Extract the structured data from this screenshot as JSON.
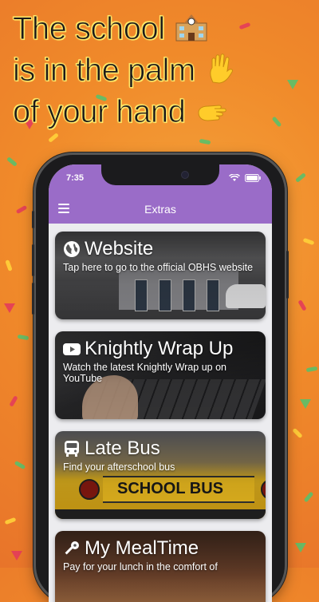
{
  "headline": {
    "line1": "The school",
    "line2": "is in the palm",
    "line3": "of your hand"
  },
  "status_bar": {
    "time": "7:35"
  },
  "nav": {
    "title": "Extras"
  },
  "cards": [
    {
      "title": "Website",
      "subtitle": "Tap here to go to the official OBHS website",
      "icon": "globe-icon"
    },
    {
      "title": "Knightly Wrap Up",
      "subtitle": "Watch the latest Knightly Wrap up on YouTube",
      "icon": "youtube-icon"
    },
    {
      "title": "Late Bus",
      "subtitle": "Find your afterschool bus",
      "icon": "bus-icon"
    },
    {
      "title": "My MealTime",
      "subtitle": "Pay for your lunch in the comfort of",
      "icon": "key-icon"
    }
  ],
  "colors": {
    "accent": "#9a6cc8",
    "background": "#f08a2a"
  }
}
